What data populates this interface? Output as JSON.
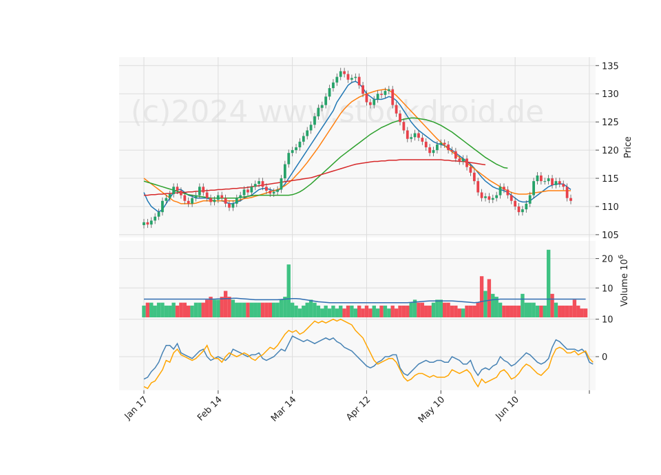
{
  "watermark": "(c)2024 www.stockdroid.de",
  "chart_data": [
    {
      "type": "candlestick",
      "panel": "price",
      "ylabel": "Price",
      "ylim": [
        104.5,
        136.5
      ],
      "yticks": [
        105,
        110,
        115,
        120,
        125,
        130,
        135
      ],
      "xticks": [
        {
          "label": "Jan 17",
          "index": 0
        },
        {
          "label": "Feb 14",
          "index": 20
        },
        {
          "label": "Mar 14",
          "index": 40
        },
        {
          "label": "Apr 12",
          "index": 60
        },
        {
          "label": "May 10",
          "index": 80
        },
        {
          "label": "Jun 10",
          "index": 100
        },
        {
          "label": "",
          "index": 120
        }
      ],
      "grid": true,
      "candles_close": [
        107.2,
        106.8,
        107.5,
        108.2,
        109.0,
        111.0,
        111.5,
        112.2,
        113.5,
        112.8,
        112.0,
        111.0,
        110.5,
        111.5,
        112.0,
        113.5,
        112.5,
        111.5,
        110.8,
        111.2,
        112.0,
        111.5,
        110.5,
        109.8,
        110.5,
        111.5,
        112.0,
        113.0,
        112.5,
        113.5,
        114.0,
        114.5,
        113.5,
        112.8,
        112.3,
        112.6,
        113.0,
        115.0,
        117.5,
        119.5,
        120.0,
        120.5,
        121.5,
        122.5,
        123.5,
        124.5,
        126.0,
        127.5,
        128.0,
        129.5,
        131.0,
        132.0,
        133.0,
        134.0,
        133.5,
        132.5,
        132.8,
        133.0,
        131.5,
        130.0,
        128.5,
        128.0,
        129.0,
        130.0,
        129.8,
        130.5,
        130.8,
        128.0,
        126.5,
        125.0,
        123.5,
        122.0,
        122.3,
        123.0,
        122.2,
        121.5,
        120.5,
        119.5,
        120.0,
        121.0,
        121.3,
        121.0,
        120.0,
        119.8,
        118.5,
        118.0,
        118.5,
        117.0,
        116.0,
        114.5,
        112.5,
        111.5,
        111.8,
        111.2,
        111.5,
        112.0,
        113.5,
        113.0,
        112.0,
        111.0,
        110.0,
        109.0,
        109.5,
        110.5,
        112.0,
        114.5,
        115.5,
        114.5,
        114.5,
        115.0,
        113.8,
        114.5,
        114.0,
        113.5,
        111.5,
        111.0
      ],
      "series": [
        {
          "name": "",
          "color": "#1f77b4",
          "values": [
            112.5,
            111.0,
            110.0,
            109.5,
            109.0,
            109.5,
            110.5,
            111.5,
            112.5,
            113.0,
            113.0,
            112.5,
            112.0,
            111.8,
            111.5,
            111.5,
            111.5,
            111.5,
            111.2,
            111.0,
            111.0,
            111.0,
            110.8,
            110.5,
            110.5,
            110.8,
            111.0,
            111.5,
            111.8,
            112.0,
            112.5,
            113.0,
            113.2,
            113.2,
            113.0,
            112.8,
            112.8,
            113.2,
            114.0,
            115.0,
            116.0,
            117.0,
            118.0,
            119.0,
            120.0,
            121.0,
            122.0,
            123.0,
            124.0,
            125.0,
            126.0,
            127.0,
            128.5,
            129.5,
            130.5,
            131.5,
            132.0,
            132.2,
            131.8,
            131.0,
            130.0,
            129.5,
            129.0,
            129.0,
            129.0,
            129.2,
            129.5,
            129.3,
            128.8,
            128.0,
            127.0,
            126.0,
            125.0,
            124.2,
            123.5,
            123.0,
            122.5,
            122.0,
            121.5,
            121.2,
            121.0,
            120.8,
            120.5,
            120.0,
            119.5,
            119.0,
            118.5,
            118.0,
            117.5,
            116.8,
            116.0,
            115.2,
            114.5,
            114.0,
            113.5,
            113.2,
            113.0,
            112.8,
            112.5,
            112.0,
            111.5,
            111.0,
            110.8,
            110.8,
            111.0,
            111.5,
            112.0,
            112.5,
            113.0,
            113.5,
            113.8,
            114.0,
            114.0,
            114.0,
            113.5,
            113.0
          ]
        },
        {
          "name": "",
          "color": "#ff7f0e",
          "values": [
            115.0,
            114.5,
            114.0,
            113.5,
            113.0,
            112.5,
            112.0,
            111.5,
            111.0,
            110.8,
            110.5,
            110.5,
            110.5,
            110.5,
            110.6,
            110.8,
            111.0,
            111.0,
            111.0,
            111.0,
            111.0,
            111.0,
            111.0,
            111.0,
            111.0,
            111.0,
            111.2,
            111.4,
            111.5,
            111.6,
            111.8,
            112.0,
            112.2,
            112.4,
            112.6,
            112.8,
            113.0,
            113.3,
            113.7,
            114.2,
            114.8,
            115.5,
            116.2,
            117.0,
            117.8,
            118.7,
            119.6,
            120.5,
            121.5,
            122.5,
            123.5,
            124.5,
            125.5,
            126.5,
            127.3,
            128.0,
            128.6,
            129.0,
            129.4,
            129.7,
            130.0,
            130.2,
            130.4,
            130.6,
            130.7,
            130.8,
            130.6,
            130.2,
            129.7,
            129.0,
            128.3,
            127.6,
            126.9,
            126.2,
            125.5,
            124.8,
            124.1,
            123.4,
            122.7,
            122.0,
            121.4,
            120.8,
            120.2,
            119.7,
            119.2,
            118.7,
            118.2,
            117.7,
            117.2,
            116.7,
            116.2,
            115.7,
            115.2,
            114.7,
            114.3,
            113.9,
            113.5,
            113.1,
            112.8,
            112.5,
            112.3,
            112.2,
            112.2,
            112.2,
            112.3,
            112.4,
            112.5,
            112.6,
            112.7,
            112.8,
            112.8,
            112.8,
            112.8,
            112.8,
            112.8,
            112.8
          ]
        },
        {
          "name": "",
          "color": "#2ca02c",
          "values": [
            114.5,
            114.3,
            114.1,
            113.9,
            113.7,
            113.5,
            113.3,
            113.1,
            112.9,
            112.7,
            112.5,
            112.3,
            112.1,
            112.0,
            111.9,
            111.8,
            111.7,
            111.6,
            111.5,
            111.5,
            111.5,
            111.5,
            111.5,
            111.5,
            111.5,
            111.5,
            111.6,
            111.7,
            111.8,
            111.9,
            112.0,
            112.0,
            112.0,
            112.0,
            112.0,
            112.0,
            112.0,
            112.0,
            112.0,
            112.0,
            112.1,
            112.3,
            112.6,
            113.0,
            113.5,
            114.0,
            114.6,
            115.2,
            115.8,
            116.4,
            117.0,
            117.6,
            118.2,
            118.8,
            119.3,
            119.8,
            120.3,
            120.8,
            121.3,
            121.8,
            122.3,
            122.8,
            123.2,
            123.6,
            124.0,
            124.3,
            124.6,
            124.9,
            125.1,
            125.3,
            125.5,
            125.6,
            125.7,
            125.7,
            125.6,
            125.5,
            125.4,
            125.2,
            125.0,
            124.7,
            124.4,
            124.0,
            123.6,
            123.2,
            122.7,
            122.2,
            121.7,
            121.2,
            120.7,
            120.2,
            119.7,
            119.2,
            118.7,
            118.3,
            117.9,
            117.5,
            117.2,
            116.9,
            116.8
          ]
        },
        {
          "name": "",
          "color": "#d62728",
          "values": [
            112.0,
            112.0,
            112.1,
            112.1,
            112.2,
            112.2,
            112.3,
            112.3,
            112.4,
            112.4,
            112.5,
            112.5,
            112.6,
            112.6,
            112.7,
            112.7,
            112.8,
            112.8,
            112.9,
            112.9,
            113.0,
            113.0,
            113.1,
            113.1,
            113.2,
            113.2,
            113.3,
            113.3,
            113.4,
            113.5,
            113.6,
            113.7,
            113.8,
            113.9,
            114.0,
            114.1,
            114.2,
            114.3,
            114.4,
            114.5,
            114.6,
            114.7,
            114.8,
            114.9,
            115.0,
            115.1,
            115.3,
            115.5,
            115.7,
            115.9,
            116.1,
            116.3,
            116.5,
            116.7,
            116.9,
            117.1,
            117.3,
            117.5,
            117.6,
            117.7,
            117.8,
            117.9,
            118.0,
            118.0,
            118.1,
            118.1,
            118.2,
            118.2,
            118.2,
            118.3,
            118.3,
            118.3,
            118.3,
            118.3,
            118.3,
            118.3,
            118.3,
            118.3,
            118.3,
            118.3,
            118.3,
            118.2,
            118.2,
            118.1,
            118.1,
            118.0,
            118.0,
            117.9,
            117.8,
            117.7,
            117.6,
            117.5,
            117.4
          ]
        }
      ]
    },
    {
      "type": "bar",
      "panel": "volume",
      "ylabel": "Volume  10^6",
      "ylim": [
        0,
        26
      ],
      "yticks": [
        10,
        20
      ],
      "values": [
        4,
        5,
        5,
        4,
        5,
        5,
        4,
        4,
        5,
        4,
        5,
        5,
        4,
        4,
        5,
        5,
        5,
        6,
        7,
        6,
        6,
        7,
        9,
        7,
        6,
        5,
        5,
        5,
        5,
        5,
        5,
        5,
        5,
        5,
        5,
        5,
        5,
        6,
        7,
        18,
        5,
        4,
        3,
        4,
        5,
        6,
        5,
        4,
        3,
        4,
        3,
        4,
        3,
        4,
        3,
        4,
        4,
        3,
        4,
        3,
        4,
        3,
        4,
        3,
        4,
        4,
        3,
        4,
        3,
        4,
        4,
        4,
        5,
        6,
        5,
        5,
        4,
        4,
        5,
        6,
        6,
        5,
        5,
        4,
        4,
        3,
        3,
        4,
        4,
        4,
        5,
        14,
        9,
        13,
        8,
        7,
        5,
        4,
        4,
        4,
        4,
        4,
        8,
        5,
        5,
        5,
        4,
        4,
        4,
        23,
        8,
        5,
        4,
        4,
        4,
        4,
        6,
        4,
        3,
        3
      ],
      "avg": [
        6.2,
        6.2,
        6.2,
        6.2,
        6.2,
        6.2,
        6.2,
        6.2,
        6.2,
        6.2,
        6.2,
        6.2,
        6.2,
        6.2,
        6.2,
        6.2,
        6.2,
        6.2,
        6.2,
        6.2,
        6.3,
        6.3,
        6.4,
        6.4,
        6.5,
        6.5,
        6.4,
        6.3,
        6.2,
        6.1,
        6.0,
        6.0,
        6.0,
        6.0,
        6.0,
        6.0,
        6.0,
        6.1,
        6.2,
        6.3,
        6.4,
        6.4,
        6.3,
        6.1,
        5.9,
        5.7,
        5.5,
        5.3,
        5.2,
        5.1,
        5.0,
        5.0,
        5.0,
        5.0,
        5.0,
        5.0,
        5.0,
        5.0,
        5.0,
        5.0,
        5.0,
        5.0,
        5.0,
        5.0,
        5.0,
        5.0,
        5.0,
        5.0,
        5.0,
        5.0,
        5.0,
        5.0,
        5.1,
        5.2,
        5.3,
        5.4,
        5.5,
        5.6,
        5.6,
        5.6,
        5.6,
        5.6,
        5.6,
        5.6,
        5.5,
        5.4,
        5.3,
        5.2,
        5.1,
        5.0,
        5.1,
        5.4,
        5.6,
        5.8,
        6.0,
        6.1,
        6.2,
        6.2,
        6.2,
        6.2,
        6.2,
        6.2,
        6.2,
        6.2,
        6.2,
        6.2,
        6.2,
        6.2,
        6.2,
        6.2,
        6.2,
        6.2,
        6.2,
        6.2,
        6.2,
        6.2,
        6.2,
        6.2,
        6.2,
        6.2
      ]
    },
    {
      "type": "line",
      "panel": "oscillator",
      "ylim": [
        -9,
        10.5
      ],
      "yticks": [
        0,
        10
      ],
      "series": [
        {
          "name": "",
          "color": "#4682b4",
          "values": [
            -6.0,
            -5.5,
            -4.0,
            -3.0,
            -1.5,
            1.0,
            3.0,
            3.0,
            2.0,
            3.5,
            1.0,
            0.5,
            0.0,
            -0.5,
            0.5,
            1.5,
            2.0,
            0.0,
            -1.0,
            -0.5,
            0.0,
            -0.5,
            -1.0,
            0.0,
            2.0,
            1.5,
            1.0,
            0.5,
            0.0,
            0.5,
            0.5,
            1.0,
            -0.5,
            -1.0,
            -0.5,
            0.0,
            1.0,
            2.0,
            1.5,
            3.5,
            5.5,
            5.0,
            4.5,
            4.0,
            4.5,
            4.0,
            3.5,
            4.0,
            4.5,
            5.0,
            4.5,
            5.0,
            4.0,
            3.5,
            2.5,
            2.0,
            1.5,
            0.5,
            -0.5,
            -1.5,
            -2.5,
            -3.0,
            -2.5,
            -1.5,
            -1.0,
            0.0,
            0.0,
            0.5,
            0.5,
            -3.0,
            -4.5,
            -5.0,
            -4.0,
            -3.0,
            -2.0,
            -1.5,
            -1.0,
            -1.5,
            -1.5,
            -1.0,
            -1.0,
            -1.5,
            -1.5,
            0.0,
            -0.5,
            -1.0,
            -2.0,
            -2.0,
            -1.0,
            -3.5,
            -5.0,
            -3.5,
            -3.0,
            -3.5,
            -2.5,
            -2.0,
            0.0,
            -1.0,
            -1.5,
            -2.5,
            -2.0,
            -1.0,
            0.0,
            1.0,
            0.5,
            -0.5,
            -1.5,
            -2.0,
            -1.5,
            -0.5,
            2.5,
            4.5,
            4.0,
            3.0,
            2.0,
            2.0,
            2.0,
            1.5,
            2.0,
            1.0,
            -1.5,
            -2.0
          ]
        },
        {
          "name": "",
          "color": "#ffa500",
          "values": [
            -8.0,
            -8.5,
            -7.0,
            -6.5,
            -5.0,
            -3.5,
            -1.0,
            -1.5,
            1.0,
            2.0,
            0.5,
            0.0,
            -0.5,
            -1.0,
            -0.5,
            0.5,
            1.5,
            3.0,
            0.5,
            -0.5,
            -0.5,
            -1.5,
            0.0,
            1.0,
            0.5,
            0.0,
            0.5,
            1.0,
            0.5,
            -0.5,
            -1.0,
            0.0,
            0.5,
            1.5,
            2.5,
            2.0,
            3.0,
            4.5,
            6.0,
            7.0,
            6.5,
            7.0,
            6.0,
            6.5,
            7.5,
            8.5,
            9.5,
            9.0,
            9.5,
            9.0,
            9.5,
            10.0,
            9.5,
            10.0,
            9.5,
            9.0,
            8.5,
            7.0,
            6.0,
            5.0,
            3.0,
            1.0,
            -1.0,
            -2.0,
            -1.5,
            -1.0,
            -0.5,
            -0.5,
            -1.5,
            -3.5,
            -5.5,
            -6.5,
            -6.0,
            -5.0,
            -4.5,
            -4.5,
            -5.0,
            -5.5,
            -5.0,
            -5.5,
            -5.5,
            -5.5,
            -5.0,
            -3.5,
            -4.0,
            -4.5,
            -4.0,
            -3.5,
            -4.5,
            -6.5,
            -8.0,
            -6.0,
            -7.0,
            -6.5,
            -6.0,
            -5.5,
            -4.0,
            -3.5,
            -4.5,
            -6.0,
            -5.5,
            -4.5,
            -3.0,
            -2.0,
            -2.5,
            -3.5,
            -4.5,
            -5.0,
            -4.0,
            -3.0,
            0.0,
            2.0,
            2.5,
            2.0,
            1.0,
            1.0,
            1.5,
            0.5,
            1.0,
            1.5,
            -0.5,
            -1.5
          ]
        }
      ]
    }
  ]
}
